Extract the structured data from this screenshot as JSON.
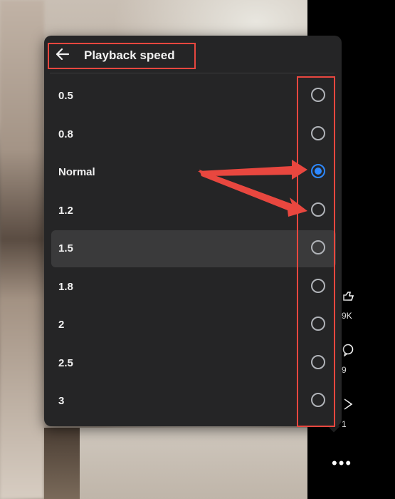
{
  "panel": {
    "title": "Playback speed",
    "back_icon": "arrow-left-icon"
  },
  "options": [
    {
      "label": "0.5",
      "selected": false
    },
    {
      "label": "0.8",
      "selected": false
    },
    {
      "label": "Normal",
      "selected": true
    },
    {
      "label": "1.2",
      "selected": false
    },
    {
      "label": "1.5",
      "selected": false,
      "hovered": true
    },
    {
      "label": "1.8",
      "selected": false
    },
    {
      "label": "2",
      "selected": false
    },
    {
      "label": "2.5",
      "selected": false
    },
    {
      "label": "3",
      "selected": false
    }
  ],
  "side_actions": {
    "likes_count": "9K",
    "comments_count": "9",
    "shares_count": "1",
    "more_label": "•••"
  },
  "colors": {
    "panel_bg": "#252526",
    "accent": "#2d88ff",
    "annotation": "#e8473f"
  }
}
